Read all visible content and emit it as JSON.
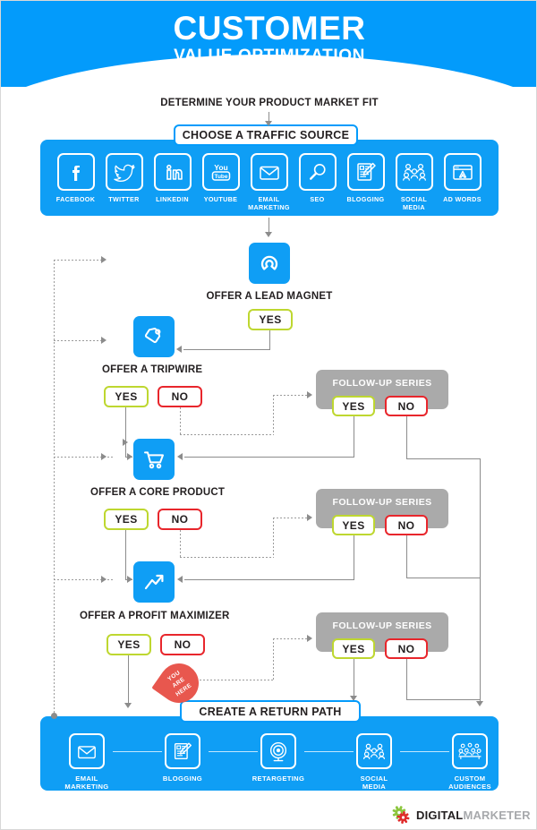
{
  "header": {
    "title_main": "CUSTOMER",
    "title_sub": "VALUE OPTIMIZATION",
    "background_color": "#039bfb"
  },
  "flow": {
    "determine_label": "DETERMINE YOUR PRODUCT MARKET FIT",
    "choose_traffic_label": "CHOOSE A TRAFFIC SOURCE",
    "return_path_label": "CREATE A RETURN PATH",
    "you_are_here": {
      "line1": "YOU",
      "line2": "ARE",
      "line3": "HERE",
      "color": "#e8574e"
    }
  },
  "traffic_sources": [
    {
      "icon": "facebook-icon",
      "label": "FACEBOOK"
    },
    {
      "icon": "twitter-icon",
      "label": "TWITTER"
    },
    {
      "icon": "linkedin-icon",
      "label": "LINKEDIN"
    },
    {
      "icon": "youtube-icon",
      "label": "YOUTUBE"
    },
    {
      "icon": "envelope-icon",
      "label": "EMAIL\nMARKETING"
    },
    {
      "icon": "magnifier-icon",
      "label": "SEO"
    },
    {
      "icon": "blog-pencil-icon",
      "label": "BLOGGING"
    },
    {
      "icon": "social-people-icon",
      "label": "SOCIAL\nMEDIA"
    },
    {
      "icon": "adwords-browser-icon",
      "label": "AD WORDS"
    }
  ],
  "steps": [
    {
      "key": "lead_magnet",
      "icon": "magnet-icon",
      "title": "OFFER A LEAD MAGNET",
      "yes_label": "YES",
      "no_label": null,
      "followup": null
    },
    {
      "key": "tripwire",
      "icon": "price-tag-icon",
      "title": "OFFER A TRIPWIRE",
      "yes_label": "YES",
      "no_label": "NO",
      "followup": {
        "title": "FOLLOW-UP SERIES",
        "yes_label": "YES",
        "no_label": "NO"
      }
    },
    {
      "key": "core_product",
      "icon": "shopping-cart-icon",
      "title": "OFFER A CORE PRODUCT",
      "yes_label": "YES",
      "no_label": "NO",
      "followup": {
        "title": "FOLLOW-UP SERIES",
        "yes_label": "YES",
        "no_label": "NO"
      }
    },
    {
      "key": "profit_maximizer",
      "icon": "growth-arrow-icon",
      "title": "OFFER A PROFIT MAXIMIZER",
      "yes_label": "YES",
      "no_label": "NO",
      "followup": {
        "title": "FOLLOW-UP SERIES",
        "yes_label": "YES",
        "no_label": "NO"
      }
    }
  ],
  "return_path": [
    {
      "icon": "envelope-icon",
      "label": "EMAIL\nMARKETING"
    },
    {
      "icon": "blog-pencil-icon",
      "label": "BLOGGING"
    },
    {
      "icon": "target-icon",
      "label": "RETARGETING"
    },
    {
      "icon": "social-people-icon",
      "label": "SOCIAL\nMEDIA"
    },
    {
      "icon": "audience-icon",
      "label": "CUSTOM\nAUDIENCES"
    }
  ],
  "footer": {
    "logo_bold": "DIGITAL",
    "logo_light": "MARKETER",
    "gear_green": "#8cc63e",
    "gear_red": "#e02b2b"
  },
  "colors": {
    "blue": "#0f9ef5",
    "yes_green": "#bed730",
    "no_red": "#e8262c",
    "gray_box": "#aaaaaa",
    "line_gray": "#8c8c8c"
  }
}
